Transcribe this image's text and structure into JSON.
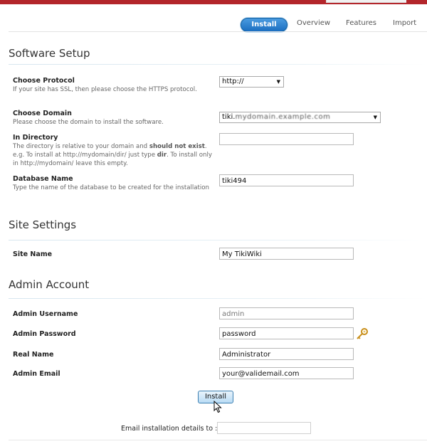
{
  "tabs": [
    {
      "label": "Install"
    },
    {
      "label": "Overview"
    },
    {
      "label": "Features"
    },
    {
      "label": "Import"
    }
  ],
  "software_setup": {
    "title": "Software Setup",
    "protocol": {
      "label": "Choose Protocol",
      "desc": "If your site has SSL, then please choose the HTTPS protocol.",
      "value": "http://"
    },
    "domain": {
      "label": "Choose Domain",
      "desc": "Please choose the domain to install the software.",
      "value_prefix": "tiki.",
      "value_blurred": "mydomain.example.com"
    },
    "directory": {
      "label": "In Directory",
      "desc_part1": "The directory is relative to your domain and ",
      "desc_bold1": "should not exist",
      "desc_part2": ". e.g. To install at http://mydomain/dir/ just type ",
      "desc_bold2": "dir",
      "desc_part3": ". To install only in http://mydomain/ leave this empty.",
      "value": ""
    },
    "database": {
      "label": "Database Name",
      "desc": "Type the name of the database to be created for the installation",
      "value": "tiki494"
    }
  },
  "site_settings": {
    "title": "Site Settings",
    "site_name": {
      "label": "Site Name",
      "value": "My TikiWiki"
    }
  },
  "admin_account": {
    "title": "Admin Account",
    "username": {
      "label": "Admin Username",
      "value": "admin"
    },
    "password": {
      "label": "Admin Password",
      "value": "password"
    },
    "real_name": {
      "label": "Real Name",
      "value": "Administrator"
    },
    "email": {
      "label": "Admin Email",
      "value": "your@validemail.com"
    }
  },
  "install_button": "Install",
  "email_details_label": "Email installation details to :",
  "email_details_value": "",
  "colors": {
    "top_bar": "#b3262b",
    "active_tab": "#1b6ec0",
    "install_button": "#b9dcf5"
  },
  "icons": {
    "password_generator": "key-icon",
    "pointer": "mouse-cursor-icon"
  }
}
